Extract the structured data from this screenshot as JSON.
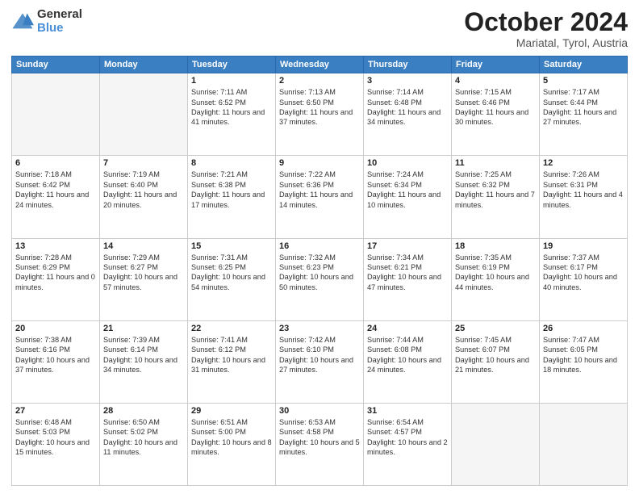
{
  "header": {
    "logo_general": "General",
    "logo_blue": "Blue",
    "month_title": "October 2024",
    "location": "Mariatal, Tyrol, Austria"
  },
  "days_of_week": [
    "Sunday",
    "Monday",
    "Tuesday",
    "Wednesday",
    "Thursday",
    "Friday",
    "Saturday"
  ],
  "weeks": [
    [
      {
        "day": "",
        "empty": true
      },
      {
        "day": "",
        "empty": true
      },
      {
        "day": "1",
        "sunrise": "Sunrise: 7:11 AM",
        "sunset": "Sunset: 6:52 PM",
        "daylight": "Daylight: 11 hours and 41 minutes."
      },
      {
        "day": "2",
        "sunrise": "Sunrise: 7:13 AM",
        "sunset": "Sunset: 6:50 PM",
        "daylight": "Daylight: 11 hours and 37 minutes."
      },
      {
        "day": "3",
        "sunrise": "Sunrise: 7:14 AM",
        "sunset": "Sunset: 6:48 PM",
        "daylight": "Daylight: 11 hours and 34 minutes."
      },
      {
        "day": "4",
        "sunrise": "Sunrise: 7:15 AM",
        "sunset": "Sunset: 6:46 PM",
        "daylight": "Daylight: 11 hours and 30 minutes."
      },
      {
        "day": "5",
        "sunrise": "Sunrise: 7:17 AM",
        "sunset": "Sunset: 6:44 PM",
        "daylight": "Daylight: 11 hours and 27 minutes."
      }
    ],
    [
      {
        "day": "6",
        "sunrise": "Sunrise: 7:18 AM",
        "sunset": "Sunset: 6:42 PM",
        "daylight": "Daylight: 11 hours and 24 minutes."
      },
      {
        "day": "7",
        "sunrise": "Sunrise: 7:19 AM",
        "sunset": "Sunset: 6:40 PM",
        "daylight": "Daylight: 11 hours and 20 minutes."
      },
      {
        "day": "8",
        "sunrise": "Sunrise: 7:21 AM",
        "sunset": "Sunset: 6:38 PM",
        "daylight": "Daylight: 11 hours and 17 minutes."
      },
      {
        "day": "9",
        "sunrise": "Sunrise: 7:22 AM",
        "sunset": "Sunset: 6:36 PM",
        "daylight": "Daylight: 11 hours and 14 minutes."
      },
      {
        "day": "10",
        "sunrise": "Sunrise: 7:24 AM",
        "sunset": "Sunset: 6:34 PM",
        "daylight": "Daylight: 11 hours and 10 minutes."
      },
      {
        "day": "11",
        "sunrise": "Sunrise: 7:25 AM",
        "sunset": "Sunset: 6:32 PM",
        "daylight": "Daylight: 11 hours and 7 minutes."
      },
      {
        "day": "12",
        "sunrise": "Sunrise: 7:26 AM",
        "sunset": "Sunset: 6:31 PM",
        "daylight": "Daylight: 11 hours and 4 minutes."
      }
    ],
    [
      {
        "day": "13",
        "sunrise": "Sunrise: 7:28 AM",
        "sunset": "Sunset: 6:29 PM",
        "daylight": "Daylight: 11 hours and 0 minutes."
      },
      {
        "day": "14",
        "sunrise": "Sunrise: 7:29 AM",
        "sunset": "Sunset: 6:27 PM",
        "daylight": "Daylight: 10 hours and 57 minutes."
      },
      {
        "day": "15",
        "sunrise": "Sunrise: 7:31 AM",
        "sunset": "Sunset: 6:25 PM",
        "daylight": "Daylight: 10 hours and 54 minutes."
      },
      {
        "day": "16",
        "sunrise": "Sunrise: 7:32 AM",
        "sunset": "Sunset: 6:23 PM",
        "daylight": "Daylight: 10 hours and 50 minutes."
      },
      {
        "day": "17",
        "sunrise": "Sunrise: 7:34 AM",
        "sunset": "Sunset: 6:21 PM",
        "daylight": "Daylight: 10 hours and 47 minutes."
      },
      {
        "day": "18",
        "sunrise": "Sunrise: 7:35 AM",
        "sunset": "Sunset: 6:19 PM",
        "daylight": "Daylight: 10 hours and 44 minutes."
      },
      {
        "day": "19",
        "sunrise": "Sunrise: 7:37 AM",
        "sunset": "Sunset: 6:17 PM",
        "daylight": "Daylight: 10 hours and 40 minutes."
      }
    ],
    [
      {
        "day": "20",
        "sunrise": "Sunrise: 7:38 AM",
        "sunset": "Sunset: 6:16 PM",
        "daylight": "Daylight: 10 hours and 37 minutes."
      },
      {
        "day": "21",
        "sunrise": "Sunrise: 7:39 AM",
        "sunset": "Sunset: 6:14 PM",
        "daylight": "Daylight: 10 hours and 34 minutes."
      },
      {
        "day": "22",
        "sunrise": "Sunrise: 7:41 AM",
        "sunset": "Sunset: 6:12 PM",
        "daylight": "Daylight: 10 hours and 31 minutes."
      },
      {
        "day": "23",
        "sunrise": "Sunrise: 7:42 AM",
        "sunset": "Sunset: 6:10 PM",
        "daylight": "Daylight: 10 hours and 27 minutes."
      },
      {
        "day": "24",
        "sunrise": "Sunrise: 7:44 AM",
        "sunset": "Sunset: 6:08 PM",
        "daylight": "Daylight: 10 hours and 24 minutes."
      },
      {
        "day": "25",
        "sunrise": "Sunrise: 7:45 AM",
        "sunset": "Sunset: 6:07 PM",
        "daylight": "Daylight: 10 hours and 21 minutes."
      },
      {
        "day": "26",
        "sunrise": "Sunrise: 7:47 AM",
        "sunset": "Sunset: 6:05 PM",
        "daylight": "Daylight: 10 hours and 18 minutes."
      }
    ],
    [
      {
        "day": "27",
        "sunrise": "Sunrise: 6:48 AM",
        "sunset": "Sunset: 5:03 PM",
        "daylight": "Daylight: 10 hours and 15 minutes."
      },
      {
        "day": "28",
        "sunrise": "Sunrise: 6:50 AM",
        "sunset": "Sunset: 5:02 PM",
        "daylight": "Daylight: 10 hours and 11 minutes."
      },
      {
        "day": "29",
        "sunrise": "Sunrise: 6:51 AM",
        "sunset": "Sunset: 5:00 PM",
        "daylight": "Daylight: 10 hours and 8 minutes."
      },
      {
        "day": "30",
        "sunrise": "Sunrise: 6:53 AM",
        "sunset": "Sunset: 4:58 PM",
        "daylight": "Daylight: 10 hours and 5 minutes."
      },
      {
        "day": "31",
        "sunrise": "Sunrise: 6:54 AM",
        "sunset": "Sunset: 4:57 PM",
        "daylight": "Daylight: 10 hours and 2 minutes."
      },
      {
        "day": "",
        "empty": true
      },
      {
        "day": "",
        "empty": true
      }
    ]
  ]
}
